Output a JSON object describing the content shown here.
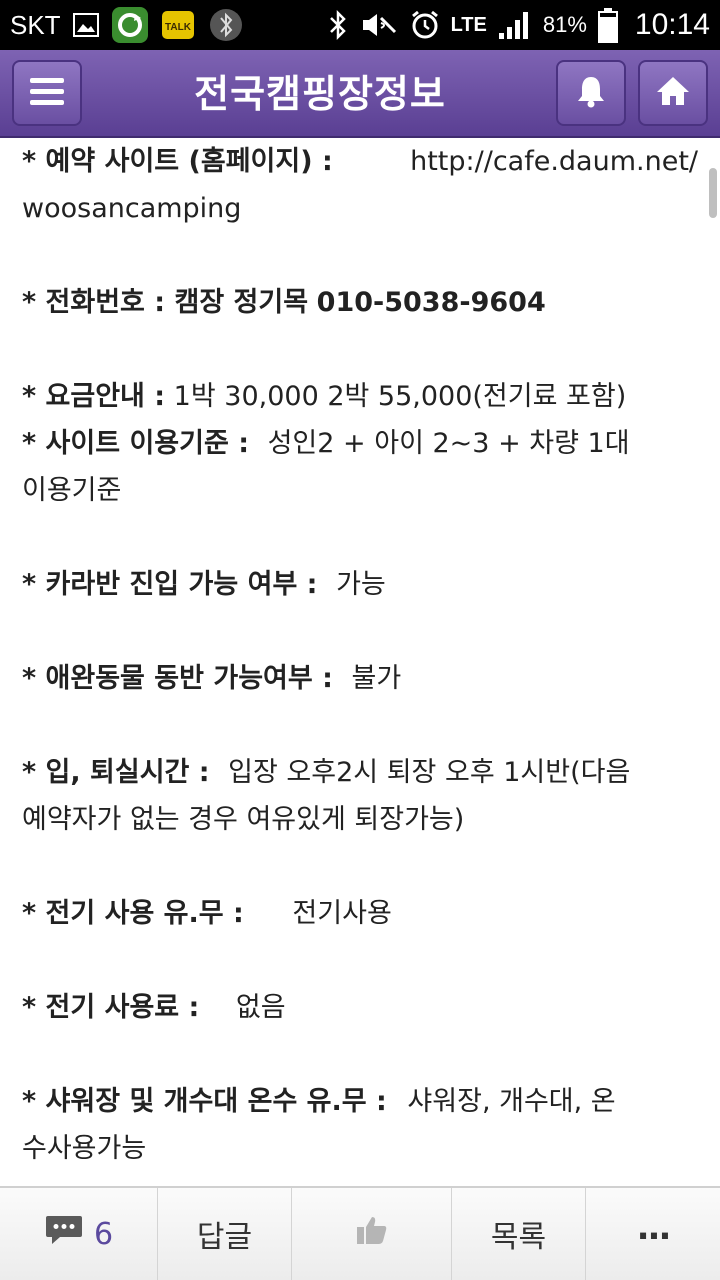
{
  "status_bar": {
    "carrier": "SKT",
    "network": "LTE",
    "battery": "81%",
    "time": "10:14",
    "left_icons": [
      "gallery-icon",
      "refresh-app-icon",
      "kakaotalk-icon",
      "bluetooth-app-icon"
    ],
    "right_icons": [
      "bluetooth-icon",
      "mute-icon",
      "alarm-icon",
      "signal-icon",
      "battery-icon"
    ]
  },
  "header": {
    "title": "전국캠핑장정보",
    "color": "#6a4fa2"
  },
  "content": {
    "reservation": {
      "label": "* 예약 사이트 (홈페이지) :",
      "url_line1": "http://cafe.daum.net/",
      "url_line2": "woosancamping"
    },
    "phone": {
      "label": "* 전화번호 : 캠장 정기목",
      "value": "010-5038-9604"
    },
    "fee": {
      "label": "* 요금안내 :",
      "value": "1박 30,000 2박 55,000(전기료 포함)"
    },
    "site_rule": {
      "label": "* 사이트 이용기준 :",
      "value_line1": "성인2 + 아이 2~3 + 차량 1대",
      "value_line2": "이용기준"
    },
    "caravan": {
      "label": "* 카라반 진입 가능 여부 :",
      "value": "가능"
    },
    "pets": {
      "label": "* 애완동물 동반 가능여부 :",
      "value": "불가"
    },
    "checkin": {
      "label": "* 입, 퇴실시간 :",
      "value_line1": "입장 오후2시 퇴장 오후 1시반(다음",
      "value_line2": "예약자가 없는 경우 여유있게 퇴장가능)"
    },
    "electric": {
      "label": "* 전기 사용 유.무 :",
      "value": "전기사용"
    },
    "electric_fee": {
      "label": "* 전기 사용료 :",
      "value": "없음"
    },
    "shower": {
      "label": "* 샤워장 및 개수대 온수 유.무 :",
      "value_line1": "샤워장, 개수대, 온",
      "value_line2": "수사용가능"
    }
  },
  "toolbar": {
    "comment_count": "6",
    "reply_label": "답글",
    "list_label": "목록",
    "more_label": "..."
  }
}
